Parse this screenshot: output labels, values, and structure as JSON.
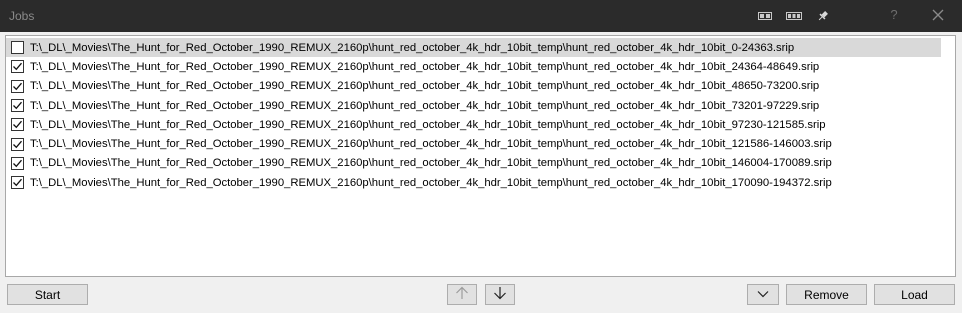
{
  "window": {
    "title": "Jobs",
    "help_glyph": "?",
    "icons": [
      "layout-split-icon",
      "layout-columns-icon",
      "pin-icon",
      "help-icon",
      "close-icon"
    ]
  },
  "jobs": [
    {
      "path": "T:\\_DL\\_Movies\\The_Hunt_for_Red_October_1990_REMUX_2160p\\hunt_red_october_4k_hdr_10bit_temp\\hunt_red_october_4k_hdr_10bit_0-24363.srip",
      "checked": false,
      "selected": true
    },
    {
      "path": "T:\\_DL\\_Movies\\The_Hunt_for_Red_October_1990_REMUX_2160p\\hunt_red_october_4k_hdr_10bit_temp\\hunt_red_october_4k_hdr_10bit_24364-48649.srip",
      "checked": true,
      "selected": false
    },
    {
      "path": "T:\\_DL\\_Movies\\The_Hunt_for_Red_October_1990_REMUX_2160p\\hunt_red_october_4k_hdr_10bit_temp\\hunt_red_october_4k_hdr_10bit_48650-73200.srip",
      "checked": true,
      "selected": false
    },
    {
      "path": "T:\\_DL\\_Movies\\The_Hunt_for_Red_October_1990_REMUX_2160p\\hunt_red_october_4k_hdr_10bit_temp\\hunt_red_october_4k_hdr_10bit_73201-97229.srip",
      "checked": true,
      "selected": false
    },
    {
      "path": "T:\\_DL\\_Movies\\The_Hunt_for_Red_October_1990_REMUX_2160p\\hunt_red_october_4k_hdr_10bit_temp\\hunt_red_october_4k_hdr_10bit_97230-121585.srip",
      "checked": true,
      "selected": false
    },
    {
      "path": "T:\\_DL\\_Movies\\The_Hunt_for_Red_October_1990_REMUX_2160p\\hunt_red_october_4k_hdr_10bit_temp\\hunt_red_october_4k_hdr_10bit_121586-146003.srip",
      "checked": true,
      "selected": false
    },
    {
      "path": "T:\\_DL\\_Movies\\The_Hunt_for_Red_October_1990_REMUX_2160p\\hunt_red_october_4k_hdr_10bit_temp\\hunt_red_october_4k_hdr_10bit_146004-170089.srip",
      "checked": true,
      "selected": false
    },
    {
      "path": "T:\\_DL\\_Movies\\The_Hunt_for_Red_October_1990_REMUX_2160p\\hunt_red_october_4k_hdr_10bit_temp\\hunt_red_october_4k_hdr_10bit_170090-194372.srip",
      "checked": true,
      "selected": false
    }
  ],
  "buttons": {
    "start": "Start",
    "move_up_icon": "arrow-up-icon",
    "move_down_icon": "arrow-down-icon",
    "menu_icon": "chevron-down-icon",
    "remove": "Remove",
    "load": "Load"
  },
  "colors": {
    "titlebar": "#2b2b2b",
    "selected_row": "#d9d9d9",
    "button_face": "#e1e1e1",
    "button_border": "#adadad"
  }
}
